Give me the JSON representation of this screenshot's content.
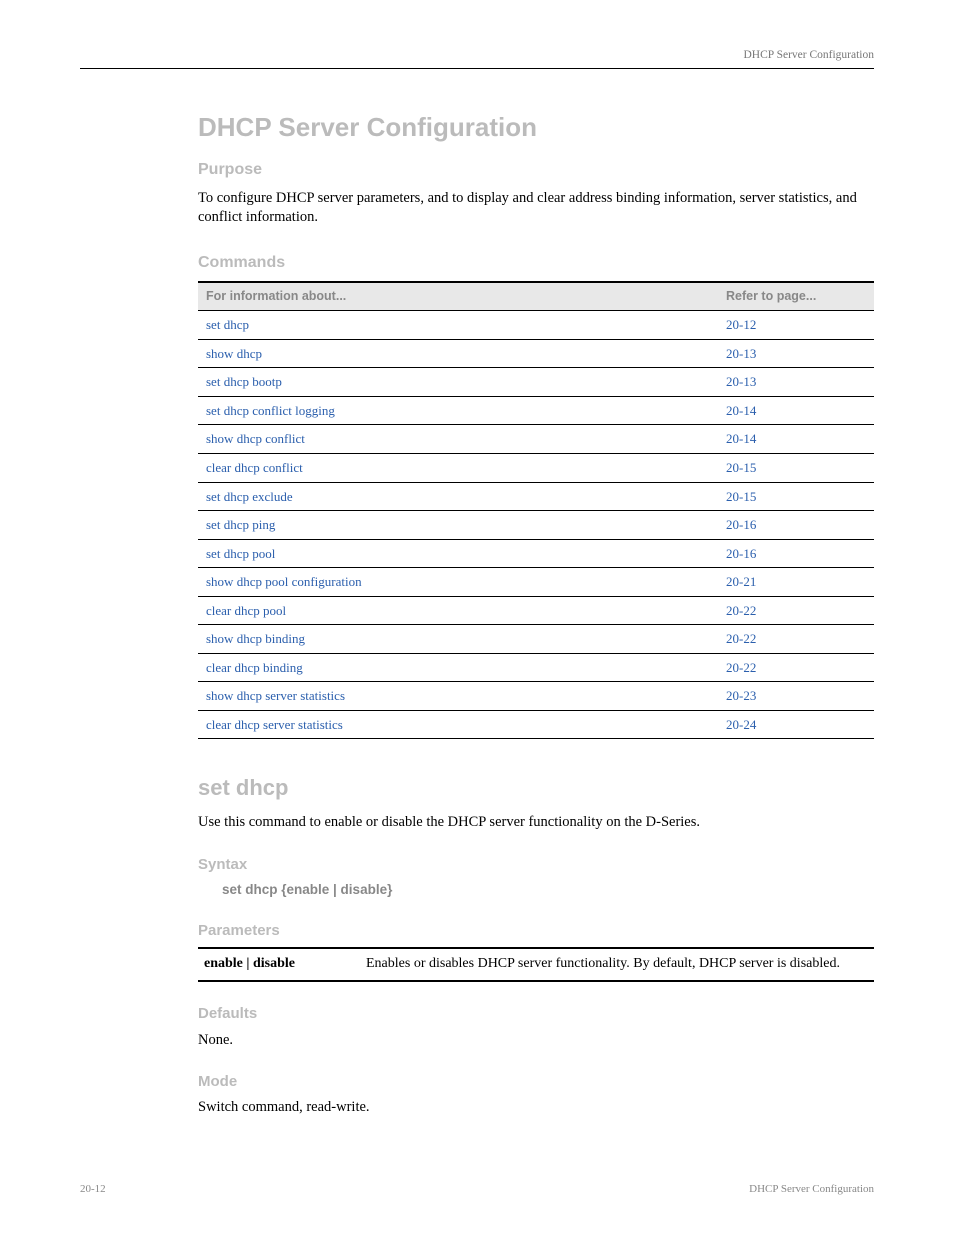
{
  "header": {
    "right_text": "DHCP Server Configuration"
  },
  "h1": "DHCP Server Configuration",
  "purpose_h": "Purpose",
  "purpose_text": "To configure DHCP server parameters, and to display and clear address binding information, server statistics, and conflict information.",
  "commands_h": "Commands",
  "table": {
    "head": [
      "For information about...",
      "Refer to page..."
    ],
    "rows": [
      [
        "set dhcp",
        "20-12"
      ],
      [
        "show dhcp",
        "20-13"
      ],
      [
        "set dhcp bootp",
        "20-13"
      ],
      [
        "set dhcp conflict logging",
        "20-14"
      ],
      [
        "show dhcp conflict",
        "20-14"
      ],
      [
        "clear dhcp conflict",
        "20-15"
      ],
      [
        "set dhcp exclude",
        "20-15"
      ],
      [
        "set dhcp ping",
        "20-16"
      ],
      [
        "set dhcp pool",
        "20-16"
      ],
      [
        "show dhcp pool configuration",
        "20-21"
      ],
      [
        "clear dhcp pool",
        "20-22"
      ],
      [
        "show dhcp binding",
        "20-22"
      ],
      [
        "clear dhcp binding",
        "20-22"
      ],
      [
        "show dhcp server statistics",
        "20-23"
      ],
      [
        "clear dhcp server statistics",
        "20-24"
      ]
    ]
  },
  "section": "set dhcp",
  "section_desc": "Use this command to enable or disable the DHCP server functionality on the D-Series.",
  "syntax_h": "Syntax",
  "syntax": "set dhcp {enable | disable}",
  "params_h": "Parameters",
  "params": [
    {
      "name": "enable | disable",
      "desc": "Enables or disables DHCP server functionality. By default, DHCP server is disabled."
    }
  ],
  "defaults_h": "Defaults",
  "defaults": "None.",
  "mode_h": "Mode",
  "mode": "Switch command, read-write.",
  "footer": {
    "left": "20-12",
    "right": "DHCP Server Configuration"
  }
}
